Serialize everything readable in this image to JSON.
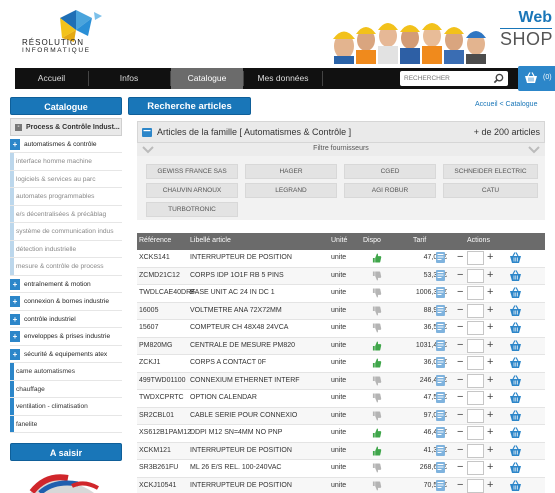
{
  "header": {
    "logo_line1": "RÉSOLUTION",
    "logo_line2": "INFORMATIQUE",
    "brand_top": "Web",
    "brand_bottom": "SHOP"
  },
  "nav": {
    "items": [
      "Accueil",
      "Infos",
      "Catalogue",
      "Mes données"
    ],
    "active": "Catalogue",
    "search_placeholder": "RECHERCHER",
    "cart_count": "(0)"
  },
  "sidebar": {
    "title": "Catalogue",
    "items": [
      {
        "label": "Process & Contrôle Indust...",
        "kind": "parent"
      },
      {
        "label": "automatismes & contrôle",
        "kind": "top-open"
      },
      {
        "label": "interface homme machine",
        "kind": "sub"
      },
      {
        "label": "logiciels & services au parc",
        "kind": "sub"
      },
      {
        "label": "automates programmables",
        "kind": "sub"
      },
      {
        "label": "e/s décentralisées & précâblag",
        "kind": "sub"
      },
      {
        "label": "système de communication indus",
        "kind": "sub"
      },
      {
        "label": "détection industrielle",
        "kind": "sub"
      },
      {
        "label": "mesure & contrôle de process",
        "kind": "sub"
      },
      {
        "label": "entraînement & motion",
        "kind": "top"
      },
      {
        "label": "connexion & bornes industrie",
        "kind": "top"
      },
      {
        "label": "contrôle industriel",
        "kind": "top"
      },
      {
        "label": "enveloppes & prises industrie",
        "kind": "top"
      },
      {
        "label": "sécurité & equipements atex",
        "kind": "top"
      },
      {
        "label": "came automatismes",
        "kind": "plain"
      },
      {
        "label": "chauffage",
        "kind": "plain"
      },
      {
        "label": "ventilation - climatisation",
        "kind": "plain"
      },
      {
        "label": "fanelite",
        "kind": "plain"
      }
    ],
    "promo_title": "A saisir"
  },
  "main": {
    "title": "Recherche articles",
    "breadcrumb": "Accueil < Catalogue",
    "famille_title": "Articles de la famille [ Automatismes & Contrôle ]",
    "famille_count": "+ de 200 articles",
    "filter_label": "Filtre fournisseurs",
    "suppliers": [
      "GEWISS FRANCE SAS",
      "HAGER",
      "CGED",
      "SCHNEIDER ELECTRIC",
      "CHAUVIN ARNOUX",
      "LEGRAND",
      "AGI ROBUR",
      "CATU",
      "TURBOTRONIC"
    ]
  },
  "table": {
    "headers": {
      "ref": "Référence",
      "lib": "Libellé article",
      "unit": "Unité",
      "dispo": "Dispo",
      "tarif": "Tarif",
      "actions": "Actions"
    },
    "rows": [
      {
        "ref": "XCKS141",
        "lib": "INTERRUPTEUR DE POSITION",
        "unit": "unite",
        "dispo": "available",
        "tarif": "47,02 €"
      },
      {
        "ref": "ZCMD21C12",
        "lib": "CORPS IDP 1O1F RB 5 PINS",
        "unit": "unite",
        "dispo": "unavailable",
        "tarif": "53,32 €"
      },
      {
        "ref": "TWDLCAE40DRF",
        "lib": "BASE UNIT AC 24 IN DC 1",
        "unit": "unite",
        "dispo": "unavailable",
        "tarif": "1006,35 €"
      },
      {
        "ref": "16005",
        "lib": "VOLTMETRE ANA 72X72MM",
        "unit": "unite",
        "dispo": "unavailable",
        "tarif": "88,93 €"
      },
      {
        "ref": "15607",
        "lib": "COMPTEUR CH 48X48 24VCA",
        "unit": "unite",
        "dispo": "unavailable",
        "tarif": "36,53 €"
      },
      {
        "ref": "PM820MG",
        "lib": "CENTRALE DE MESURE PM820",
        "unit": "unite",
        "dispo": "available",
        "tarif": "1031,40 €"
      },
      {
        "ref": "ZCKJ1",
        "lib": "CORPS A CONTACT 0F",
        "unit": "unite",
        "dispo": "available",
        "tarif": "36,04 €"
      },
      {
        "ref": "499TWD01100",
        "lib": "CONNEXIUM ETHERNET INTERF",
        "unit": "unite",
        "dispo": "unavailable",
        "tarif": "246,42 €"
      },
      {
        "ref": "TWDXCPRTC",
        "lib": "OPTION CALENDAR",
        "unit": "unite",
        "dispo": "unavailable",
        "tarif": "47,51 €"
      },
      {
        "ref": "SR2CBL01",
        "lib": "CABLE SERIE POUR CONNEXIO",
        "unit": "unite",
        "dispo": "unavailable",
        "tarif": "97,07 €"
      },
      {
        "ref": "XS612B1PAM12",
        "lib": "DDPI M12 SN=4MM NO PNP",
        "unit": "unite",
        "dispo": "available",
        "tarif": "46,45 €"
      },
      {
        "ref": "XCKM121",
        "lib": "INTERRUPTEUR DE POSITION",
        "unit": "unite",
        "dispo": "available",
        "tarif": "41,35 €"
      },
      {
        "ref": "SR3B261FU",
        "lib": "ML 26 E/S REL. 100-240VAC",
        "unit": "unite",
        "dispo": "unavailable",
        "tarif": "268,65 €"
      },
      {
        "ref": "XCKJ10541",
        "lib": "INTERRUPTEUR DE POSITION",
        "unit": "unite",
        "dispo": "unavailable",
        "tarif": "70,50 €"
      }
    ]
  },
  "colors": {
    "accent": "#1976b8",
    "nav_bg": "#111111",
    "header_row": "#6b6b6b",
    "available": "#3fa64a",
    "unavailable": "#b5b5b5"
  }
}
